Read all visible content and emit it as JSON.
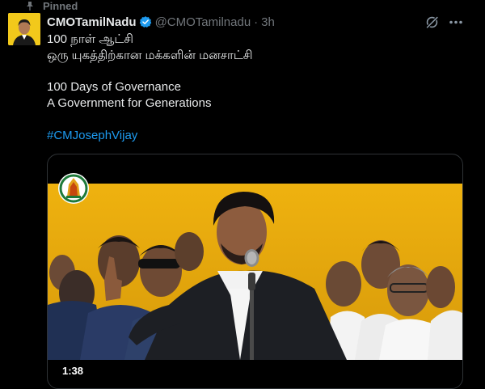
{
  "pinned": {
    "label": "Pinned",
    "icon": "pin-icon"
  },
  "tweet": {
    "display_name": "CMOTamilNadu",
    "handle": "@CMOTamilnadu",
    "separator": "·",
    "time": "3h",
    "verified_icon": "verified-badge-icon",
    "lines": [
      "100 நாள் ஆட்சி",
      "ஒரு யுகத்திற்கான மக்களின் மனசாட்சி",
      "100 Days of Governance",
      "A Government for Generations"
    ],
    "hashtag": "#CMJosephVijay"
  },
  "media": {
    "duration": "1:38",
    "icons": [
      "tamilnadu-seal-icon",
      "video-thumbnail"
    ]
  },
  "actions": {
    "grok": "grok-icon",
    "more": "more-options-icon"
  },
  "colors": {
    "background": "#000000",
    "text": "#e7e9ea",
    "muted": "#71767b",
    "link": "#1d9bf0",
    "verified": "#1d9bf0",
    "stage": "#e6a80c"
  }
}
